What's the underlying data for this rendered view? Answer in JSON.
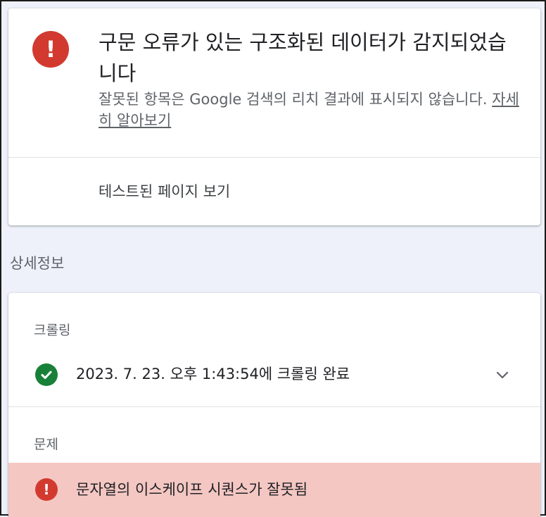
{
  "status_card": {
    "icon": "error-icon",
    "headline": "구문 오류가 있는 구조화된 데이터가 감지되었습니다",
    "description": "잘못된 항목은 Google 검색의 리치 결과에 표시되지 않습니다.",
    "learn_more": "자세히 알아보기",
    "view_tested_page": "테스트된 페이지 보기",
    "error_color": "#d33a2f"
  },
  "details": {
    "title": "상세정보",
    "crawl": {
      "label": "크롤링",
      "icon": "check-circle-icon",
      "status_text": "2023. 7. 23. 오후 1:43:54에 크롤링 완료",
      "expand_icon": "chevron-down-icon",
      "ok_color": "#188038"
    },
    "issues": {
      "label": "문제",
      "items": [
        {
          "icon": "error-icon",
          "text": "문자열의 이스케이프 시퀀스가 잘못됨",
          "highlight_color": "#f4c7c3"
        }
      ]
    }
  }
}
